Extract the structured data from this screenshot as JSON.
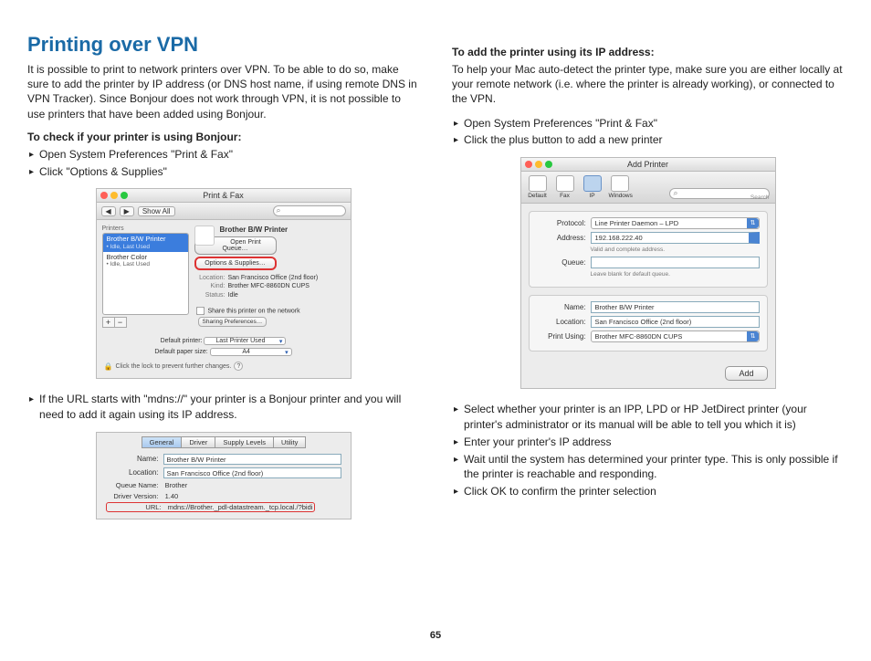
{
  "page_number": "65",
  "left": {
    "heading": "Printing over VPN",
    "intro": "It is possible to print to network printers over VPN. To be able to do so, make sure to add the printer by IP address (or DNS host name, if using remote DNS in VPN Tracker). Since Bonjour does not work through VPN, it is not possible to use printers that have been added using Bonjour.",
    "check_heading": "To check if your printer is using Bonjour:",
    "check_bullets": [
      "Open System Preferences \"Print & Fax\"",
      "Click \"Options & Supplies\""
    ],
    "mdns_bullet": "If the URL starts with \"mdns://\" your printer is a Bonjour printer and you will need to add it again using its IP address."
  },
  "right": {
    "add_heading": "To add the printer using its IP address:",
    "add_intro": "To help your Mac auto-detect the printer type, make sure you are either locally at your remote network (i.e. where the printer is already working), or connected to the VPN.",
    "pre_bullets": [
      "Open System Preferences  \"Print & Fax\"",
      "Click the plus button to add a new printer"
    ],
    "post_bullets": [
      "Select whether your printer is an IPP, LPD or HP JetDirect printer (your printer's administrator or its manual will be able to tell you which it is)",
      "Enter your printer's IP address",
      "Wait until the system has determined your printer type. This is only possible if the printer is reachable and responding.",
      "Click OK to confirm the printer selection"
    ]
  },
  "printfax": {
    "title": "Print & Fax",
    "show_all": "Show All",
    "printers_label": "Printers",
    "printer1_name": "Brother B/W Printer",
    "printer1_status": "• Idle, Last Used",
    "printer2_name": "Brother Color",
    "printer2_status": "• Idle, Last Used",
    "right_title": "Brother B/W Printer",
    "btn_open_queue": "Open Print Queue…",
    "btn_options": "Options & Supplies…",
    "loc_label": "Location:",
    "loc_value": "San Francisco Office (2nd floor)",
    "kind_label": "Kind:",
    "kind_value": "Brother MFC-8860DN CUPS",
    "status_label": "Status:",
    "status_value": "Idle",
    "share_label": "Share this printer on the network",
    "share_prefs_btn": "Sharing Preferences…",
    "default_printer_label": "Default printer:",
    "default_printer_value": "Last Printer Used",
    "default_paper_label": "Default paper size:",
    "default_paper_value": "A4",
    "lock_text": "Click the lock to prevent further changes."
  },
  "general_tab": {
    "tabs": {
      "general": "General",
      "driver": "Driver",
      "supply": "Supply Levels",
      "utility": "Utility"
    },
    "name_label": "Name:",
    "name_value": "Brother B/W Printer",
    "location_label": "Location:",
    "location_value": "San Francisco Office (2nd floor)",
    "queue_label": "Queue Name:",
    "queue_value": "Brother",
    "driver_label": "Driver Version:",
    "driver_value": "1.40",
    "url_label": "URL:",
    "url_value": "mdns://Brother._pdl-datastream._tcp.local./?bidi"
  },
  "add_printer": {
    "title": "Add Printer",
    "toolbar": {
      "default": "Default",
      "fax": "Fax",
      "ip": "IP",
      "windows": "Windows",
      "search": "Search"
    },
    "protocol_label": "Protocol:",
    "protocol_value": "Line Printer Daemon – LPD",
    "address_label": "Address:",
    "address_value": "192.168.222.40",
    "address_hint": "Valid and complete address.",
    "queue_label": "Queue:",
    "queue_value": "",
    "queue_hint": "Leave blank for default queue.",
    "name_label": "Name:",
    "name_value": "Brother B/W Printer",
    "location_label": "Location:",
    "location_value": "San Francisco Office (2nd floor)",
    "printusing_label": "Print Using:",
    "printusing_value": "Brother MFC-8860DN CUPS",
    "add_btn": "Add"
  }
}
